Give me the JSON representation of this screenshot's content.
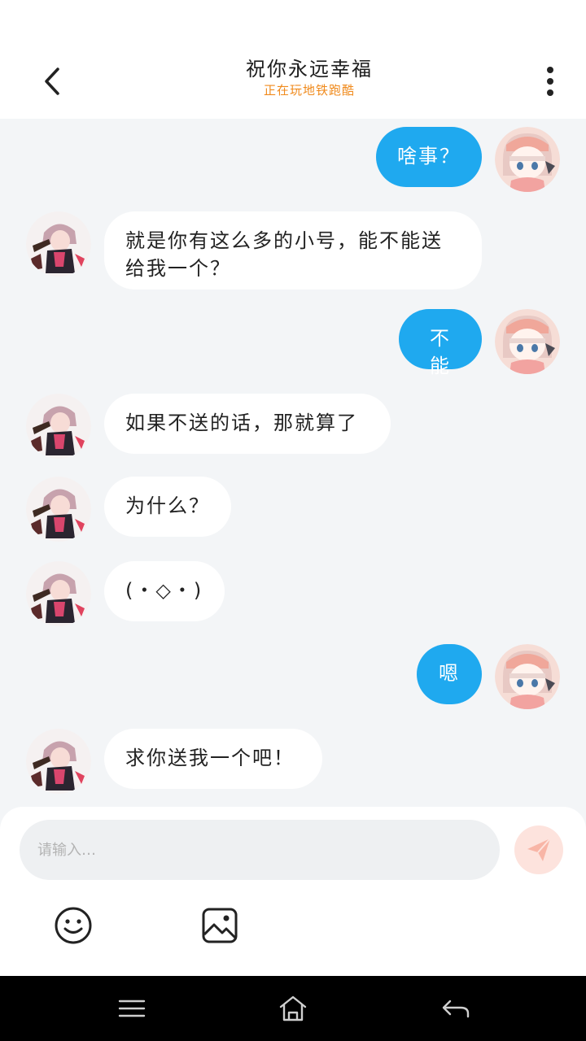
{
  "header": {
    "title": "祝你永远幸福",
    "status": "正在玩地铁跑酷",
    "back_icon": "chevron-left-icon",
    "more_icon": "more-vertical-icon"
  },
  "messages": [
    {
      "side": "right",
      "text": "啥事？"
    },
    {
      "side": "left",
      "text": "就是你有这么多的小号，能不能送给我一个？"
    },
    {
      "side": "right",
      "text": "不能"
    },
    {
      "side": "left",
      "text": "如果不送的话，那就算了"
    },
    {
      "side": "left",
      "text": "为什么？"
    },
    {
      "side": "left",
      "text": "(・◇・)"
    },
    {
      "side": "right",
      "text": "嗯"
    },
    {
      "side": "left",
      "text": "求你送我一个吧！"
    }
  ],
  "composer": {
    "placeholder": "请输入…",
    "send_icon": "paper-plane-icon",
    "emoji_icon": "smiley-icon",
    "image_icon": "image-icon"
  },
  "colors": {
    "outgoing_bubble": "#1fa9ef",
    "incoming_bubble": "#ffffff",
    "chat_background": "#f3f5f7",
    "status_text": "#f08a1c",
    "send_button": "#fde3dd"
  },
  "navbar": {
    "icons": [
      "menu-icon",
      "home-icon",
      "back-arrow-icon"
    ]
  }
}
